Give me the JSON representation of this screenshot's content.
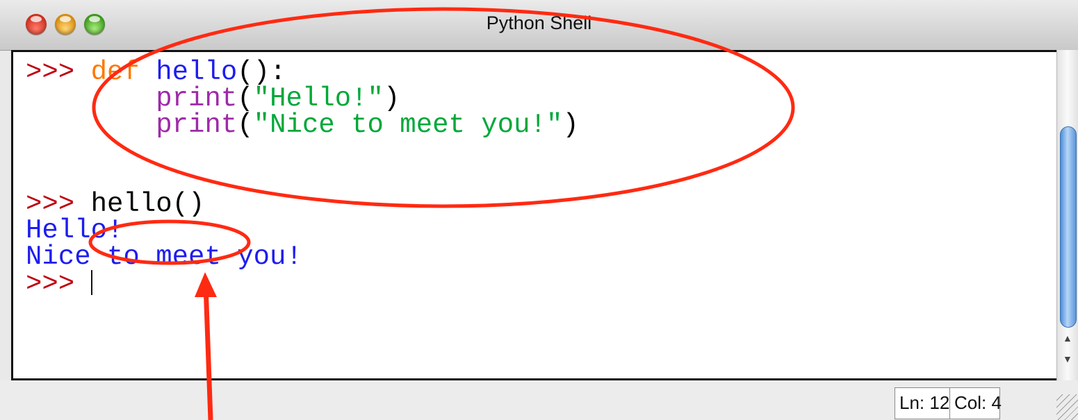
{
  "window": {
    "title": "Python Shell",
    "controls": [
      "close-button",
      "minimize-button",
      "zoom-button"
    ]
  },
  "shell": {
    "prompt": ">>>",
    "lines": [
      {
        "prompt": ">>>",
        "keyword": "def",
        "func": "hello",
        "rest": "():"
      },
      {
        "indent": "        ",
        "builtin": "print",
        "open": "(",
        "string": "\"Hello!\"",
        "close": ")"
      },
      {
        "indent": "        ",
        "builtin": "print",
        "open": "(",
        "string": "\"Nice to meet you!\"",
        "close": ")"
      },
      {
        "prompt": ">>>",
        "code": "hello()"
      },
      {
        "output": "Hello!"
      },
      {
        "output": "Nice to meet you!"
      },
      {
        "prompt": ">>>"
      }
    ]
  },
  "status": {
    "line": "Ln: 12",
    "column": "Col: 4"
  },
  "colors": {
    "prompt": "#c0000f",
    "keyword": "#ff7700",
    "function": "#1d1df0",
    "builtin": "#9e2aa8",
    "string": "#00a83a",
    "output": "#1d1df0",
    "annotation": "#ff2a12"
  },
  "icons": {
    "scroll_up": "up-arrow-icon",
    "scroll_down": "down-arrow-icon",
    "resize": "resize-grip-icon"
  }
}
